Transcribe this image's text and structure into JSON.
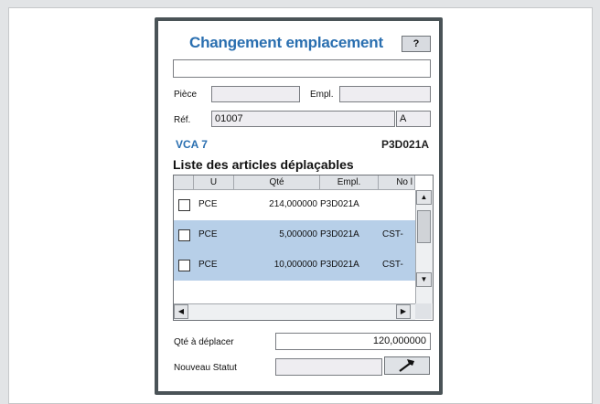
{
  "form": {
    "title": "Changement emplacement",
    "help_label": "?",
    "top_input_value": "",
    "piece_label": "Pièce",
    "piece_value": "",
    "empl_label": "Empl.",
    "empl_value": "",
    "ref_label": "Réf.",
    "ref_value": "01007",
    "ref_suffix": "A",
    "vca": "VCA 7",
    "location_code": "P3D021A"
  },
  "list": {
    "title": "Liste des articles déplaçables",
    "columns": [
      "U",
      "Qté",
      "Empl.",
      "No l"
    ],
    "rows": [
      {
        "unit": "PCE",
        "qty": "214,000000",
        "empl": "P3D021A",
        "extra": "",
        "selected": false,
        "checked": false
      },
      {
        "unit": "PCE",
        "qty": "5,000000",
        "empl": "P3D021A",
        "extra": "CST-",
        "selected": true,
        "checked": false
      },
      {
        "unit": "PCE",
        "qty": "10,000000",
        "empl": "P3D021A",
        "extra": "CST-",
        "selected": true,
        "checked": false
      }
    ]
  },
  "footer": {
    "qty_label": "Qté à déplacer",
    "qty_value": "120,000000",
    "status_label": "Nouveau Statut",
    "status_value": ""
  },
  "icons": {
    "scroll_up": "triangle-up",
    "scroll_down": "triangle-down",
    "scroll_left": "triangle-left",
    "scroll_right": "triangle-right",
    "status_button": "hammer-icon"
  }
}
